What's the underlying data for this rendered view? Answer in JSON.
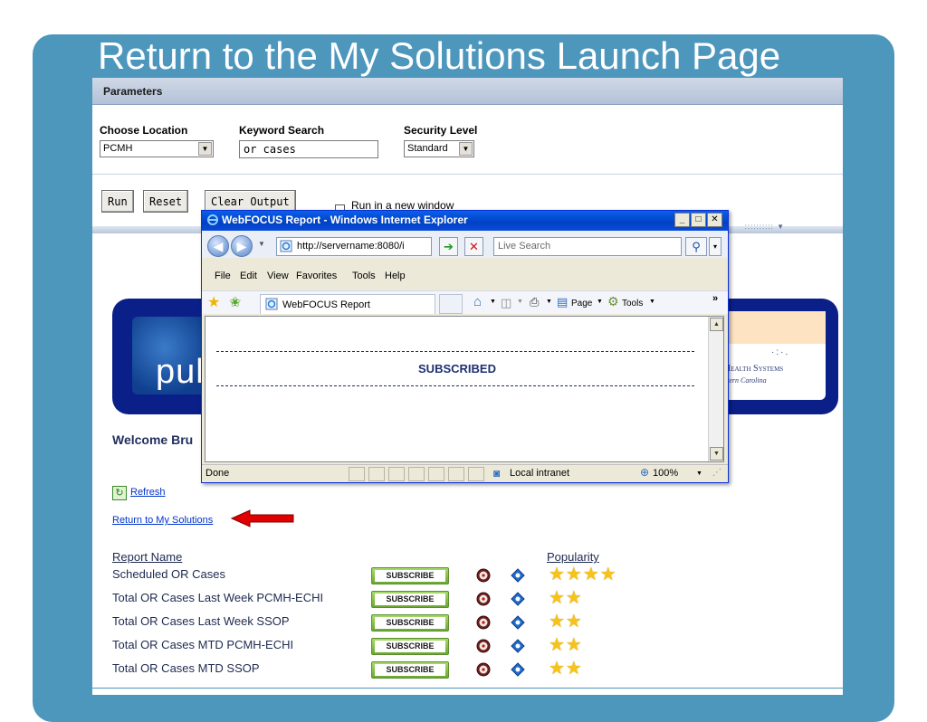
{
  "slide": {
    "title": "Return to the My Solutions Launch Page"
  },
  "parameters": {
    "header": "Parameters",
    "location_label": "Choose Location",
    "location_value": "PCMH",
    "keyword_label": "Keyword Search",
    "keyword_value": "or cases",
    "security_label": "Security Level",
    "security_value": "Standard",
    "run_label": "Run",
    "reset_label": "Reset",
    "clear_label": "Clear Output",
    "new_window_label": "Run in a new window"
  },
  "popup": {
    "title": "WebFOCUS Report - Windows Internet Explorer",
    "address": "http://servername:8080/i",
    "search_placeholder": "Live Search",
    "menu": [
      "File",
      "Edit",
      "View",
      "Favorites",
      "Tools",
      "Help"
    ],
    "tab_label": "WebFOCUS Report",
    "page_label": "Page",
    "tools_label": "Tools",
    "content_text": "SUBSCRIBED",
    "status_text": "Done",
    "zone_text": "Local intranet",
    "zoom_text": "100%"
  },
  "banner": {
    "logo_text": "puls",
    "right_title": "Health Systems",
    "right_sub": "stern Carolina"
  },
  "page": {
    "welcome": "Welcome Bru",
    "refresh": "Refresh",
    "return_link": "Return to My Solutions"
  },
  "reports": {
    "col_name": "Report Name",
    "col_popularity": "Popularity",
    "subscribe_label": "SUBSCRIBE",
    "rows": [
      {
        "name": "Scheduled OR Cases",
        "stars": "★★★★",
        "rating": 4
      },
      {
        "name": "Total OR Cases Last Week PCMH-ECHI",
        "stars": "★★",
        "rating": 2
      },
      {
        "name": "Total OR Cases Last Week SSOP",
        "stars": "★★",
        "rating": 2
      },
      {
        "name": "Total OR Cases MTD PCMH-ECHI",
        "stars": "★★",
        "rating": 2
      },
      {
        "name": "Total OR Cases MTD SSOP",
        "stars": "★★",
        "rating": 2
      }
    ]
  },
  "colors": {
    "slide_bg": "#4d97bd",
    "banner_bg": "#0b1f88",
    "link": "#0033cc",
    "star": "#f6c31a",
    "subscribe_green": "#6aa834",
    "arrow_red": "#e00000"
  }
}
